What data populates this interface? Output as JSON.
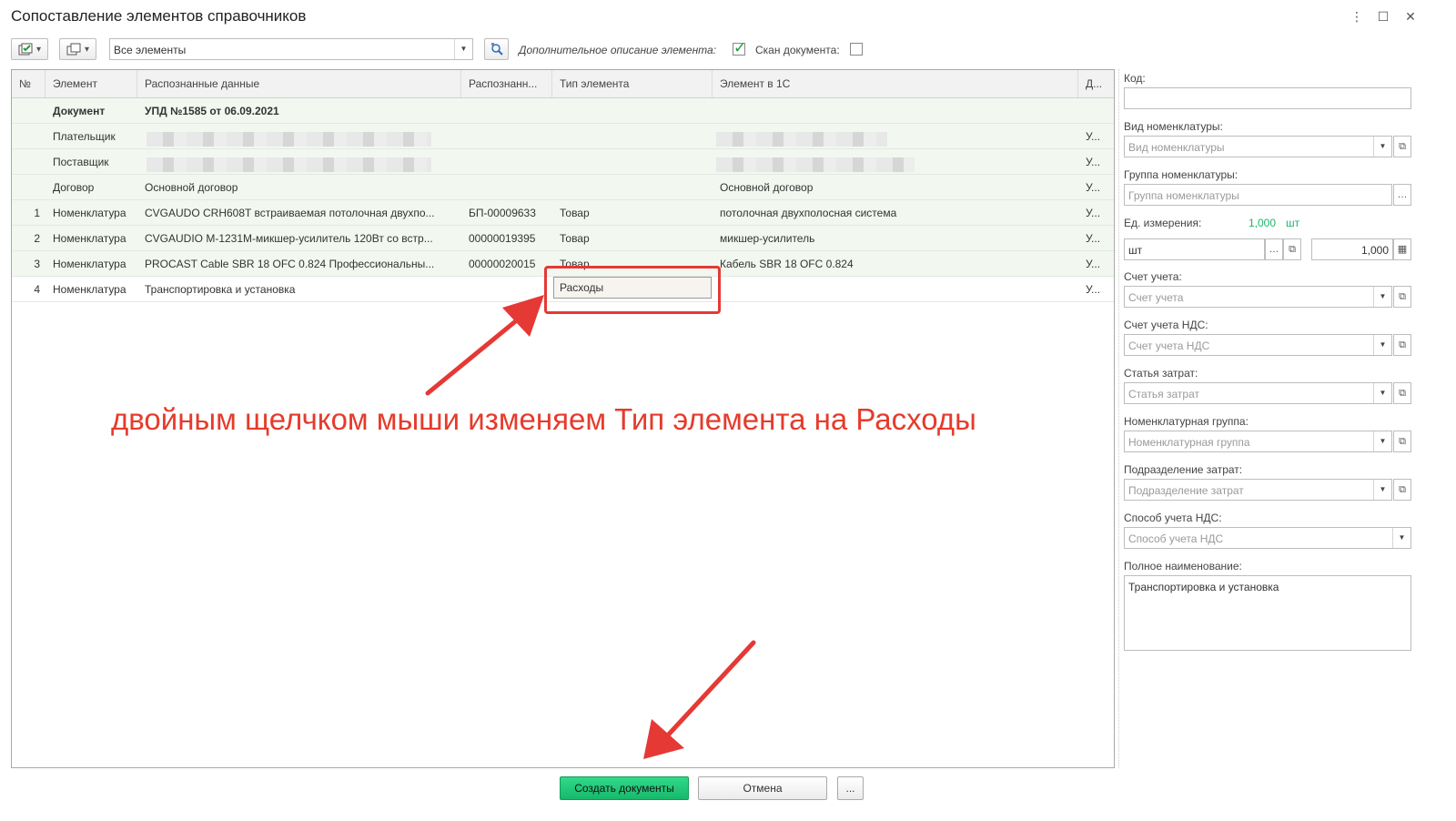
{
  "window": {
    "title": "Сопоставление элементов справочников"
  },
  "toolbar": {
    "filter_value": "Все элементы",
    "extra_desc_label": "Дополнительное описание элемента:",
    "extra_desc_checked": true,
    "scan_label": "Скан документа:",
    "scan_checked": false
  },
  "grid": {
    "columns": [
      "№",
      "Элемент",
      "Распознанные данные",
      "Распознанн...",
      "Тип элемента",
      "Элемент в 1С",
      "Д..."
    ],
    "rows": [
      {
        "num": "",
        "element": "Документ",
        "recognized": "УПД №1585 от 06.09.2021",
        "code": "",
        "type": "",
        "element1c": "",
        "d": "",
        "bold": true
      },
      {
        "num": "",
        "element": "Плательщик",
        "recognized": "",
        "code": "",
        "type": "",
        "element1c": "",
        "d": "У..."
      },
      {
        "num": "",
        "element": "Поставщик",
        "recognized": "",
        "code": "",
        "type": "",
        "element1c": "",
        "d": "У..."
      },
      {
        "num": "",
        "element": "Договор",
        "recognized": "Основной договор",
        "code": "",
        "type": "",
        "element1c": "Основной договор",
        "d": "У..."
      },
      {
        "num": "1",
        "element": "Номенклатура",
        "recognized": "CVGAUDO CRH608T встраиваемая потолочная двухпо...",
        "code": "БП-00009633",
        "type": "Товар",
        "element1c": "потолочная двухполосная система",
        "d": "У..."
      },
      {
        "num": "2",
        "element": "Номенклатура",
        "recognized": "CVGAUDIO M-1231M-микшер-усилитель 120Вт со встр...",
        "code": "00000019395",
        "type": "Товар",
        "element1c": "микшер-усилитель",
        "d": "У..."
      },
      {
        "num": "3",
        "element": "Номенклатура",
        "recognized": "PROCAST Cable SBR 18 OFC 0.824 Профессиональны...",
        "code": "00000020015",
        "type": "Товар",
        "element1c": "Кабель SBR 18 OFC 0.824",
        "d": "У..."
      },
      {
        "num": "4",
        "element": "Номенклатура",
        "recognized": "Транспортировка и установка",
        "code": "",
        "type": "",
        "element1c": "",
        "d": "У..."
      }
    ],
    "editing_value": "Расходы"
  },
  "annotation": "двойным щелчком мыши изменяем Тип элемента на Расходы",
  "side": {
    "code_label": "Код:",
    "vid_label": "Вид номенклатуры:",
    "vid_ph": "Вид номенклатуры",
    "group_label": "Группа номенклатуры:",
    "group_ph": "Группа номенклатуры",
    "unit_label": "Ед. измерения:",
    "unit_qty": "1,000",
    "unit_name": "шт",
    "unit_field": "шт",
    "unit_coef": "1,000",
    "account_label": "Счет учета:",
    "account_ph": "Счет учета",
    "vat_account_label": "Счет учета НДС:",
    "vat_account_ph": "Счет учета НДС",
    "cost_item_label": "Статья затрат:",
    "cost_item_ph": "Статья затрат",
    "nom_group_label": "Номенклатурная группа:",
    "nom_group_ph": "Номенклатурная группа",
    "dept_label": "Подразделение затрат:",
    "dept_ph": "Подразделение затрат",
    "vat_method_label": "Способ учета НДС:",
    "vat_method_ph": "Способ учета НДС",
    "full_name_label": "Полное наименование:",
    "full_name": "Транспортировка и установка"
  },
  "buttons": {
    "create": "Создать документы",
    "cancel": "Отмена",
    "more": "..."
  },
  "colors": {
    "accent_green": "#17b86a",
    "annotation_red": "#e53935",
    "row_green": "#f2f8ef"
  }
}
